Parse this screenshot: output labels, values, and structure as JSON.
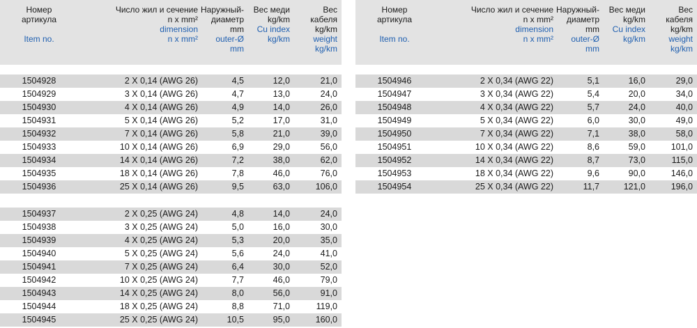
{
  "headers": {
    "article_ru": [
      "Номер",
      "артикула"
    ],
    "article_en": "Item no.",
    "section_ru": [
      "Число жил и сечение",
      "n x mm²"
    ],
    "section_en": [
      "dimension",
      "n x mm²"
    ],
    "diameter_ru": [
      "Наружный-",
      "диаметр",
      "mm"
    ],
    "diameter_en": [
      "outer-Ø",
      "mm"
    ],
    "copper_ru": [
      "Вес меди",
      "kg/km"
    ],
    "copper_en": [
      "Cu index",
      "kg/km"
    ],
    "weight_ru": [
      "Вес",
      "кабеля",
      "kg/km"
    ],
    "weight_en": [
      "weight",
      "kg/km"
    ]
  },
  "left_groups": [
    [
      [
        "1504928",
        "2 X 0,14 (AWG 26)",
        "4,5",
        "12,0",
        "21,0"
      ],
      [
        "1504929",
        "3 X 0,14 (AWG 26)",
        "4,7",
        "13,0",
        "24,0"
      ],
      [
        "1504930",
        "4 X 0,14 (AWG 26)",
        "4,9",
        "14,0",
        "26,0"
      ],
      [
        "1504931",
        "5 X 0,14 (AWG 26)",
        "5,2",
        "17,0",
        "31,0"
      ],
      [
        "1504932",
        "7 X 0,14 (AWG 26)",
        "5,8",
        "21,0",
        "39,0"
      ],
      [
        "1504933",
        "10 X 0,14 (AWG 26)",
        "6,9",
        "29,0",
        "56,0"
      ],
      [
        "1504934",
        "14 X 0,14 (AWG 26)",
        "7,2",
        "38,0",
        "62,0"
      ],
      [
        "1504935",
        "18 X 0,14 (AWG 26)",
        "7,8",
        "46,0",
        "76,0"
      ],
      [
        "1504936",
        "25 X 0,14 (AWG 26)",
        "9,5",
        "63,0",
        "106,0"
      ]
    ],
    [
      [
        "1504937",
        "2 X 0,25 (AWG 24)",
        "4,8",
        "14,0",
        "24,0"
      ],
      [
        "1504938",
        "3 X 0,25 (AWG 24)",
        "5,0",
        "16,0",
        "30,0"
      ],
      [
        "1504939",
        "4 X 0,25 (AWG 24)",
        "5,3",
        "20,0",
        "35,0"
      ],
      [
        "1504940",
        "5 X 0,25 (AWG 24)",
        "5,6",
        "24,0",
        "41,0"
      ],
      [
        "1504941",
        "7 X 0,25 (AWG 24)",
        "6,4",
        "30,0",
        "52,0"
      ],
      [
        "1504942",
        "10 X 0,25 (AWG 24)",
        "7,7",
        "46,0",
        "79,0"
      ],
      [
        "1504943",
        "14 X 0,25 (AWG 24)",
        "8,0",
        "56,0",
        "91,0"
      ],
      [
        "1504944",
        "18 X 0,25 (AWG 24)",
        "8,8",
        "71,0",
        "119,0"
      ],
      [
        "1504945",
        "25 X 0,25 (AWG 24)",
        "10,5",
        "95,0",
        "160,0"
      ]
    ]
  ],
  "right_groups": [
    [
      [
        "1504946",
        "2 X 0,34 (AWG 22)",
        "5,1",
        "16,0",
        "29,0"
      ],
      [
        "1504947",
        "3 X 0,34 (AWG 22)",
        "5,4",
        "20,0",
        "34,0"
      ],
      [
        "1504948",
        "4 X 0,34 (AWG 22)",
        "5,7",
        "24,0",
        "40,0"
      ],
      [
        "1504949",
        "5 X 0,34 (AWG 22)",
        "6,0",
        "30,0",
        "49,0"
      ],
      [
        "1504950",
        "7 X 0,34 (AWG 22)",
        "7,1",
        "38,0",
        "58,0"
      ],
      [
        "1504951",
        "10 X 0,34 (AWG 22)",
        "8,6",
        "59,0",
        "101,0"
      ],
      [
        "1504952",
        "14 X 0,34 (AWG 22)",
        "8,7",
        "73,0",
        "115,0"
      ],
      [
        "1504953",
        "18 X 0,34 (AWG 22)",
        "9,6",
        "90,0",
        "146,0"
      ],
      [
        "1504954",
        "25 X 0,34 (AWG 22)",
        "11,7",
        "121,0",
        "196,0"
      ]
    ]
  ],
  "colors": {
    "header_bg": "#e3e3e3",
    "row_shade": "#d9d9d9",
    "english_text": "#1f5fb0"
  }
}
